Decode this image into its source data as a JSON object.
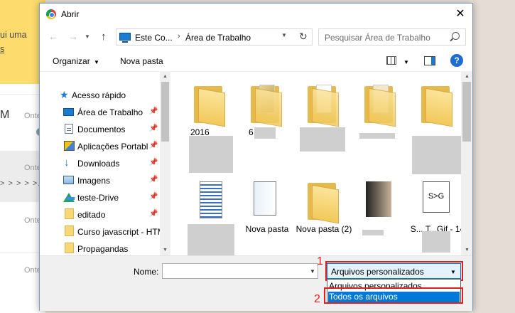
{
  "background_app": {
    "banner_line1": "ui uma",
    "banner_line2": "s",
    "contact_initial": "M",
    "time_label": "Onte",
    "preview_arrows": "> > > > >."
  },
  "dialog": {
    "title": "Abrir",
    "address": {
      "segment1": "Este Co...",
      "separator": "›",
      "segment2": "Área de Trabalho"
    },
    "search_placeholder": "Pesquisar Área de Trabalho",
    "toolbar": {
      "organize_label": "Organizar",
      "new_folder_label": "Nova pasta",
      "help_label": "?"
    },
    "sidebar": {
      "items": [
        {
          "label": "Acesso rápido",
          "icon": "star-icon",
          "pinned": false
        },
        {
          "label": "Área de Trabalho",
          "icon": "desktop-icon",
          "pinned": true
        },
        {
          "label": "Documentos",
          "icon": "documents-icon",
          "pinned": true
        },
        {
          "label": "Aplicações Portabl",
          "icon": "apps-icon",
          "pinned": true
        },
        {
          "label": "Downloads",
          "icon": "download-icon",
          "pinned": true
        },
        {
          "label": "Imagens",
          "icon": "images-icon",
          "pinned": true
        },
        {
          "label": "teste-Drive",
          "icon": "drive-icon",
          "pinned": true
        },
        {
          "label": "editado",
          "icon": "folder-icon",
          "pinned": true
        },
        {
          "label": "Curso javascript - HTM",
          "icon": "folder-icon",
          "pinned": false
        },
        {
          "label": "Propagandas",
          "icon": "folder-icon",
          "pinned": false
        }
      ]
    },
    "files": [
      {
        "label": "2016",
        "type": "folder"
      },
      {
        "label": "6",
        "type": "folder"
      },
      {
        "label": "",
        "type": "folder"
      },
      {
        "label": "",
        "type": "folder"
      },
      {
        "label": "",
        "type": "folder"
      },
      {
        "label": "",
        "type": "document"
      },
      {
        "label": "Nova pasta",
        "type": "file"
      },
      {
        "label": "Nova pasta (2)",
        "type": "folder"
      },
      {
        "label": "",
        "type": "image"
      },
      {
        "label": "S... T...Gif - 14",
        "type": "file"
      }
    ],
    "footer": {
      "name_label": "Nome:",
      "name_value": "",
      "file_type_selected": "Arquivos personalizados",
      "file_type_options": [
        "Arquivos personalizados",
        "Todos os arquivos"
      ],
      "annotation_1": "1",
      "annotation_2": "2"
    }
  },
  "colors": {
    "accent": "#0078d7",
    "annotation_red": "#e0201f",
    "banner_yellow": "#fddc6d"
  }
}
